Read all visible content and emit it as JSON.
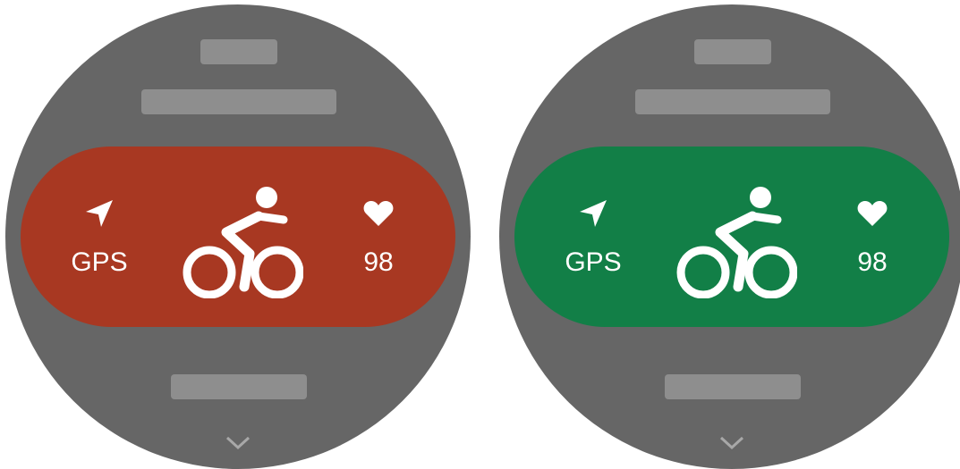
{
  "watches": [
    {
      "accent": "#a83822",
      "gps": {
        "icon": "navigation-arrow-icon",
        "label": "GPS"
      },
      "activity": {
        "icon": "cycling-icon"
      },
      "heart_rate": {
        "icon": "heart-icon",
        "value": "98"
      },
      "scroll": {
        "icon": "chevron-down-icon"
      }
    },
    {
      "accent": "#127f47",
      "gps": {
        "icon": "navigation-arrow-icon",
        "label": "GPS"
      },
      "activity": {
        "icon": "cycling-icon"
      },
      "heart_rate": {
        "icon": "heart-icon",
        "value": "98"
      },
      "scroll": {
        "icon": "chevron-down-icon"
      }
    }
  ]
}
